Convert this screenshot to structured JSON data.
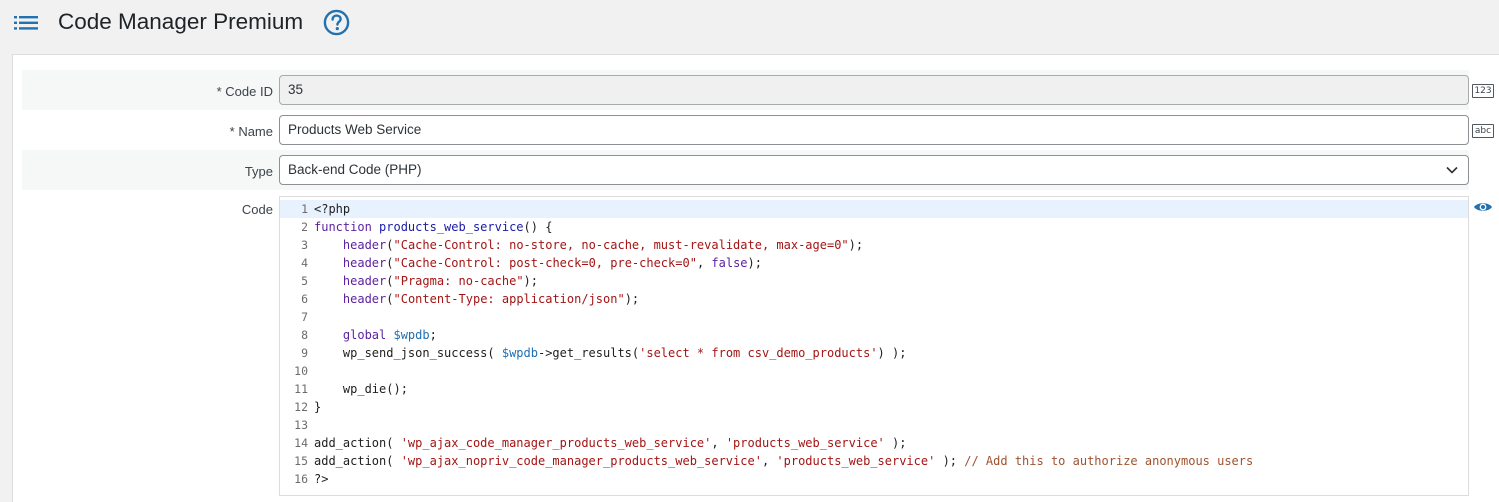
{
  "header": {
    "title": "Code Manager Premium"
  },
  "form": {
    "code_id": {
      "label": "Code ID",
      "required_mark": "*",
      "value": "35",
      "badge": "123"
    },
    "name": {
      "label": "Name",
      "required_mark": "*",
      "value": "Products Web Service",
      "badge": "abc"
    },
    "type": {
      "label": "Type",
      "value": "Back-end Code (PHP)"
    },
    "code": {
      "label": "Code"
    }
  },
  "editor": {
    "lines": [
      {
        "n": "1",
        "tokens": [
          [
            "plain",
            "<?php"
          ]
        ]
      },
      {
        "n": "2",
        "tokens": [
          [
            "kw",
            "function "
          ],
          [
            "fn",
            "products_web_service"
          ],
          [
            "plain",
            "() {"
          ]
        ]
      },
      {
        "n": "3",
        "tokens": [
          [
            "plain",
            "    "
          ],
          [
            "kw",
            "header"
          ],
          [
            "plain",
            "("
          ],
          [
            "str",
            "\"Cache-Control: no-store, no-cache, must-revalidate, max-age=0\""
          ],
          [
            "plain",
            ");"
          ]
        ]
      },
      {
        "n": "4",
        "tokens": [
          [
            "plain",
            "    "
          ],
          [
            "kw",
            "header"
          ],
          [
            "plain",
            "("
          ],
          [
            "str",
            "\"Cache-Control: post-check=0, pre-check=0\""
          ],
          [
            "plain",
            ", "
          ],
          [
            "kw",
            "false"
          ],
          [
            "plain",
            ");"
          ]
        ]
      },
      {
        "n": "5",
        "tokens": [
          [
            "plain",
            "    "
          ],
          [
            "kw",
            "header"
          ],
          [
            "plain",
            "("
          ],
          [
            "str",
            "\"Pragma: no-cache\""
          ],
          [
            "plain",
            ");"
          ]
        ]
      },
      {
        "n": "6",
        "tokens": [
          [
            "plain",
            "    "
          ],
          [
            "kw",
            "header"
          ],
          [
            "plain",
            "("
          ],
          [
            "str",
            "\"Content-Type: application/json\""
          ],
          [
            "plain",
            ");"
          ]
        ]
      },
      {
        "n": "7",
        "tokens": []
      },
      {
        "n": "8",
        "tokens": [
          [
            "plain",
            "    "
          ],
          [
            "kw",
            "global "
          ],
          [
            "var",
            "$wpdb"
          ],
          [
            "plain",
            ";"
          ]
        ]
      },
      {
        "n": "9",
        "tokens": [
          [
            "plain",
            "    wp_send_json_success( "
          ],
          [
            "var",
            "$wpdb"
          ],
          [
            "plain",
            "->get_results("
          ],
          [
            "str",
            "'select * from csv_demo_products'"
          ],
          [
            "plain",
            ") );"
          ]
        ]
      },
      {
        "n": "10",
        "tokens": []
      },
      {
        "n": "11",
        "tokens": [
          [
            "plain",
            "    wp_die();"
          ]
        ]
      },
      {
        "n": "12",
        "tokens": [
          [
            "plain",
            "}"
          ]
        ]
      },
      {
        "n": "13",
        "tokens": []
      },
      {
        "n": "14",
        "tokens": [
          [
            "plain",
            "add_action( "
          ],
          [
            "str",
            "'wp_ajax_code_manager_products_web_service'"
          ],
          [
            "plain",
            ", "
          ],
          [
            "str",
            "'products_web_service'"
          ],
          [
            "plain",
            " );"
          ]
        ]
      },
      {
        "n": "15",
        "tokens": [
          [
            "plain",
            "add_action( "
          ],
          [
            "str",
            "'wp_ajax_nopriv_code_manager_products_web_service'"
          ],
          [
            "plain",
            ", "
          ],
          [
            "str",
            "'products_web_service'"
          ],
          [
            "plain",
            " ); "
          ],
          [
            "cm",
            "// Add this to authorize anonymous users"
          ]
        ]
      },
      {
        "n": "16",
        "tokens": [
          [
            "plain",
            "?>"
          ]
        ]
      }
    ],
    "active_line": 1
  },
  "icons": {
    "menu": "list-menu-icon",
    "help": "help-circle-icon",
    "chevron": "chevron-down-icon",
    "preview": "eye-icon"
  },
  "colors": {
    "accent": "#2271b1",
    "active_line": "#e8f2ff"
  }
}
